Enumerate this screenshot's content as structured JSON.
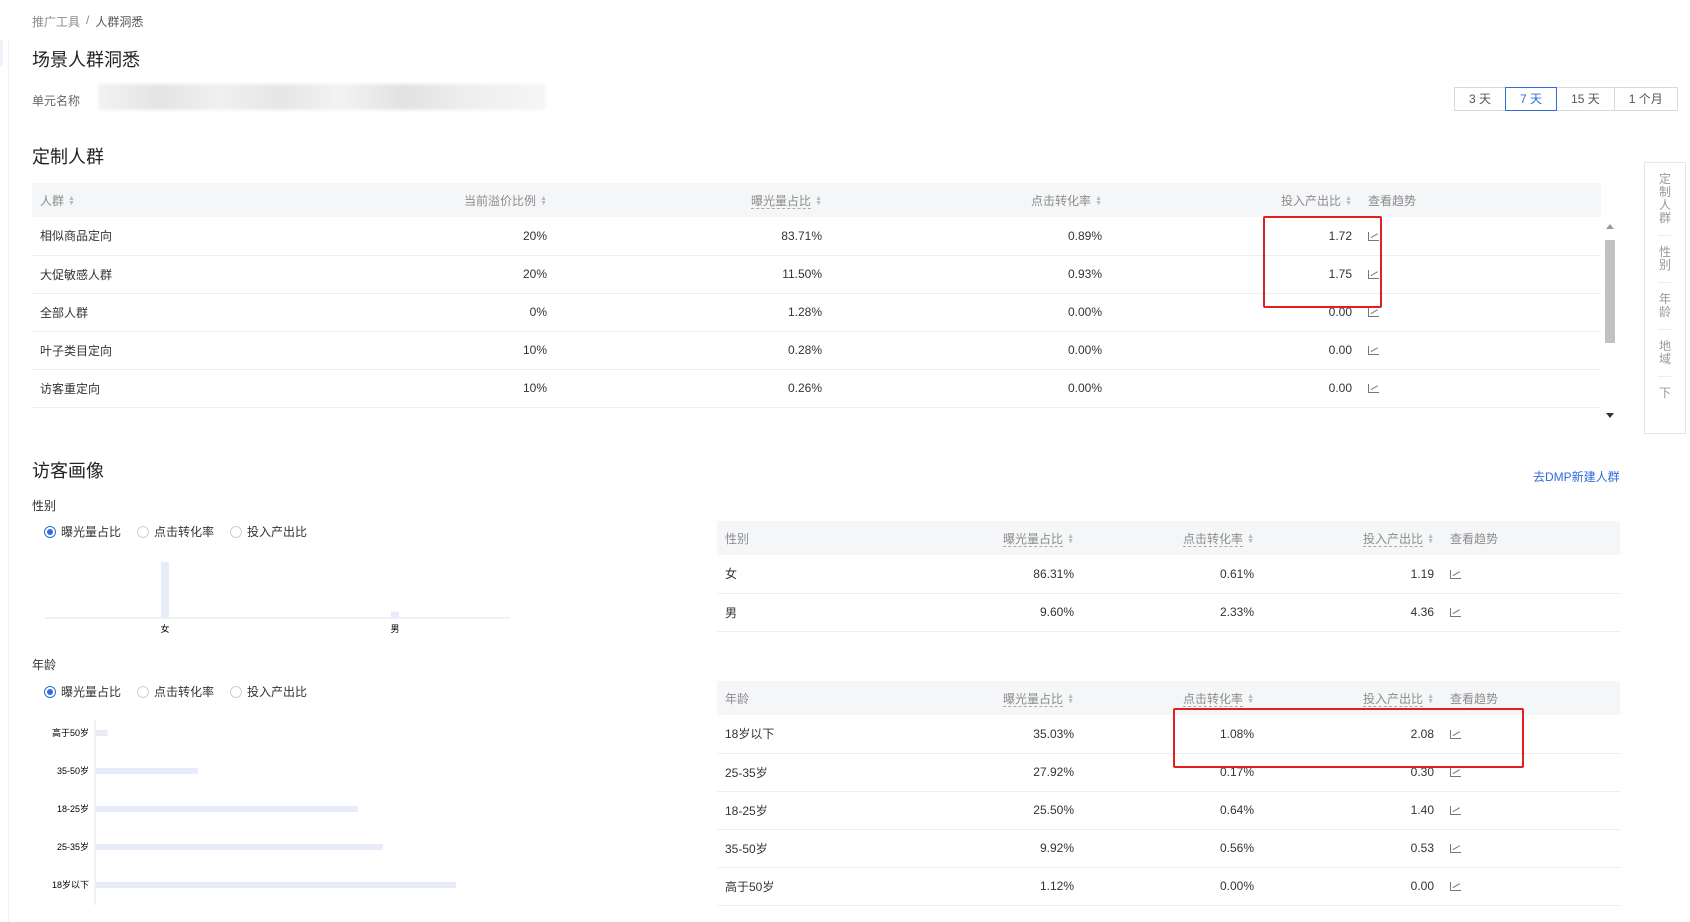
{
  "breadcrumb": [
    "推广工具",
    "人群洞悉"
  ],
  "page_title": "场景人群洞悉",
  "unit_label": "单元名称",
  "date_range": {
    "options": [
      "3 天",
      "7 天",
      "15 天",
      "1 个月"
    ],
    "active": "7 天"
  },
  "custom": {
    "title": "定制人群",
    "columns": [
      "人群",
      "当前溢价比例",
      "曝光量占比",
      "点击转化率",
      "投入产出比",
      "查看趋势"
    ],
    "rows": [
      [
        "相似商品定向",
        "20%",
        "83.71%",
        "0.89%",
        "1.72"
      ],
      [
        "大促敏感人群",
        "20%",
        "11.50%",
        "0.93%",
        "1.75"
      ],
      [
        "全部人群",
        "0%",
        "1.28%",
        "0.00%",
        "0.00"
      ],
      [
        "叶子类目定向",
        "10%",
        "0.28%",
        "0.00%",
        "0.00"
      ],
      [
        "访客重定向",
        "10%",
        "0.26%",
        "0.00%",
        "0.00"
      ]
    ]
  },
  "side_nav": [
    "定制人群",
    "性别",
    "年龄",
    "地域",
    "下"
  ],
  "visitor": {
    "title": "访客画像",
    "dmp_link": "去DMP新建人群",
    "metrics": [
      "曝光量占比",
      "点击转化率",
      "投入产出比"
    ],
    "gender": {
      "label": "性别",
      "columns": [
        "性别",
        "曝光量占比",
        "点击转化率",
        "投入产出比",
        "查看趋势"
      ],
      "rows": [
        [
          "女",
          "86.31%",
          "0.61%",
          "1.19"
        ],
        [
          "男",
          "9.60%",
          "2.33%",
          "4.36"
        ]
      ]
    },
    "age": {
      "label": "年龄",
      "columns": [
        "年龄",
        "曝光量占比",
        "点击转化率",
        "投入产出比",
        "查看趋势"
      ],
      "rows": [
        [
          "18岁以下",
          "35.03%",
          "1.08%",
          "2.08"
        ],
        [
          "25-35岁",
          "27.92%",
          "0.17%",
          "0.30"
        ],
        [
          "18-25岁",
          "25.50%",
          "0.64%",
          "1.40"
        ],
        [
          "35-50岁",
          "9.92%",
          "0.56%",
          "0.53"
        ],
        [
          "高于50岁",
          "1.12%",
          "0.00%",
          "0.00"
        ]
      ]
    }
  },
  "chart_data": [
    {
      "type": "bar",
      "categories": [
        "女",
        "男"
      ],
      "values": [
        86.31,
        9.6
      ],
      "title": "",
      "xlabel": "",
      "ylabel": ""
    },
    {
      "type": "bar",
      "orientation": "horizontal",
      "categories": [
        "高于50岁",
        "35-50岁",
        "18-25岁",
        "25-35岁",
        "18岁以下"
      ],
      "values": [
        1.12,
        9.92,
        25.5,
        27.92,
        35.03
      ],
      "title": "",
      "xlabel": "",
      "ylabel": ""
    }
  ],
  "colors": {
    "accent": "#2f6bd9",
    "highlight": "#e02020",
    "bar": "#e8ecf8"
  }
}
